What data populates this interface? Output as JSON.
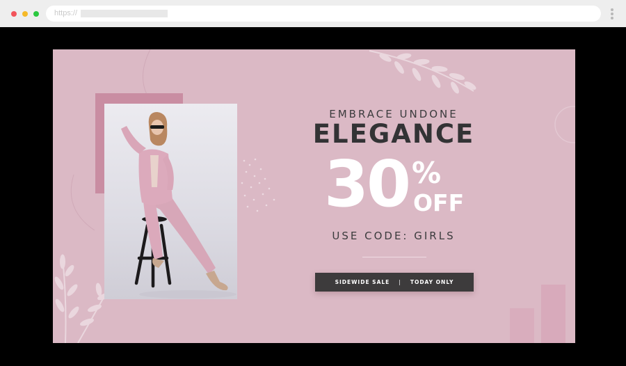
{
  "browser": {
    "url_prefix": "https://",
    "colors": {
      "close": "#f2545b",
      "minimize": "#f5b928",
      "maximize": "#2bc840"
    }
  },
  "banner": {
    "tagline": "EMBRACE UNDONE",
    "title": "ELEGANCE",
    "discount": {
      "number": "30",
      "percent": "%",
      "off": "OFF"
    },
    "promo": "USE CODE: GIRLS",
    "sale_left": "SIDEWIDE SALE",
    "sale_separator": "|",
    "sale_right": "TODAY ONLY",
    "colors": {
      "background": "#dbb9c5",
      "accent_block": "#c98da2",
      "dark_text": "#333335",
      "pill": "#3d3b3c"
    }
  }
}
